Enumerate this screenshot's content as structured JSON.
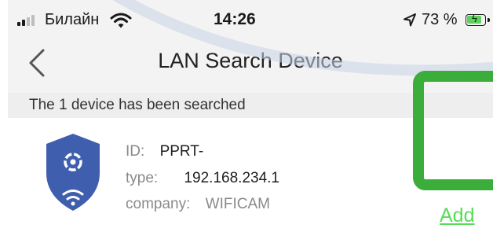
{
  "status_bar": {
    "carrier": "Билайн",
    "time": "14:26",
    "battery_percent": "73 %",
    "battery_level": 0.73,
    "icons": [
      "signal-icon",
      "wifi-icon",
      "location-arrow-icon",
      "battery-icon"
    ]
  },
  "nav": {
    "back_icon": "chevron-left-icon",
    "title": "LAN Search Device"
  },
  "banner": {
    "text": "The 1 device has been searched"
  },
  "device": {
    "icon": "camera-shield-icon",
    "fields": [
      {
        "label": "ID:",
        "value": "PPRT-"
      },
      {
        "label": "type:",
        "value": "192.168.234.1"
      },
      {
        "label": "company:",
        "value": "WIFICAM"
      }
    ],
    "add_label": "Add"
  },
  "colors": {
    "add_link": "#55dd55",
    "shield": "#3f5fae",
    "highlight_box": "#3aad3a",
    "battery_fill": "#5bd25b"
  }
}
